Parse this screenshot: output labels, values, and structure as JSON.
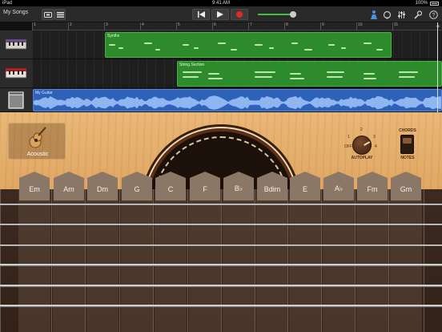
{
  "status_bar": {
    "carrier": "iPad",
    "time": "9:41 AM",
    "battery": "100%"
  },
  "toolbar": {
    "my_songs": "My Songs"
  },
  "ruler": {
    "marks": [
      "1",
      "2",
      "3",
      "4",
      "5",
      "6",
      "7",
      "8",
      "9",
      "10",
      "11"
    ]
  },
  "tracks": [
    {
      "region_name": "Synths"
    },
    {
      "region_name": "String Section"
    },
    {
      "region_name": "My Guitar"
    }
  ],
  "instrument": {
    "name": "Acoustic",
    "autoplay": {
      "label": "AUTOPLAY",
      "off_label": "OFF",
      "positions": [
        "1",
        "2",
        "3",
        "4"
      ]
    },
    "mode_switch": {
      "top_label": "CHORDS",
      "bottom_label": "NOTES"
    },
    "chords": [
      "Em",
      "Am",
      "Dm",
      "G",
      "C",
      "F",
      "B♭",
      "Bdim",
      "E",
      "A♭",
      "Fm",
      "Gm"
    ]
  },
  "colors": {
    "midi_region": "#2e8b2c",
    "audio_region": "#2d62b8",
    "record": "#e02a2a",
    "level": "#3fbf3f"
  }
}
